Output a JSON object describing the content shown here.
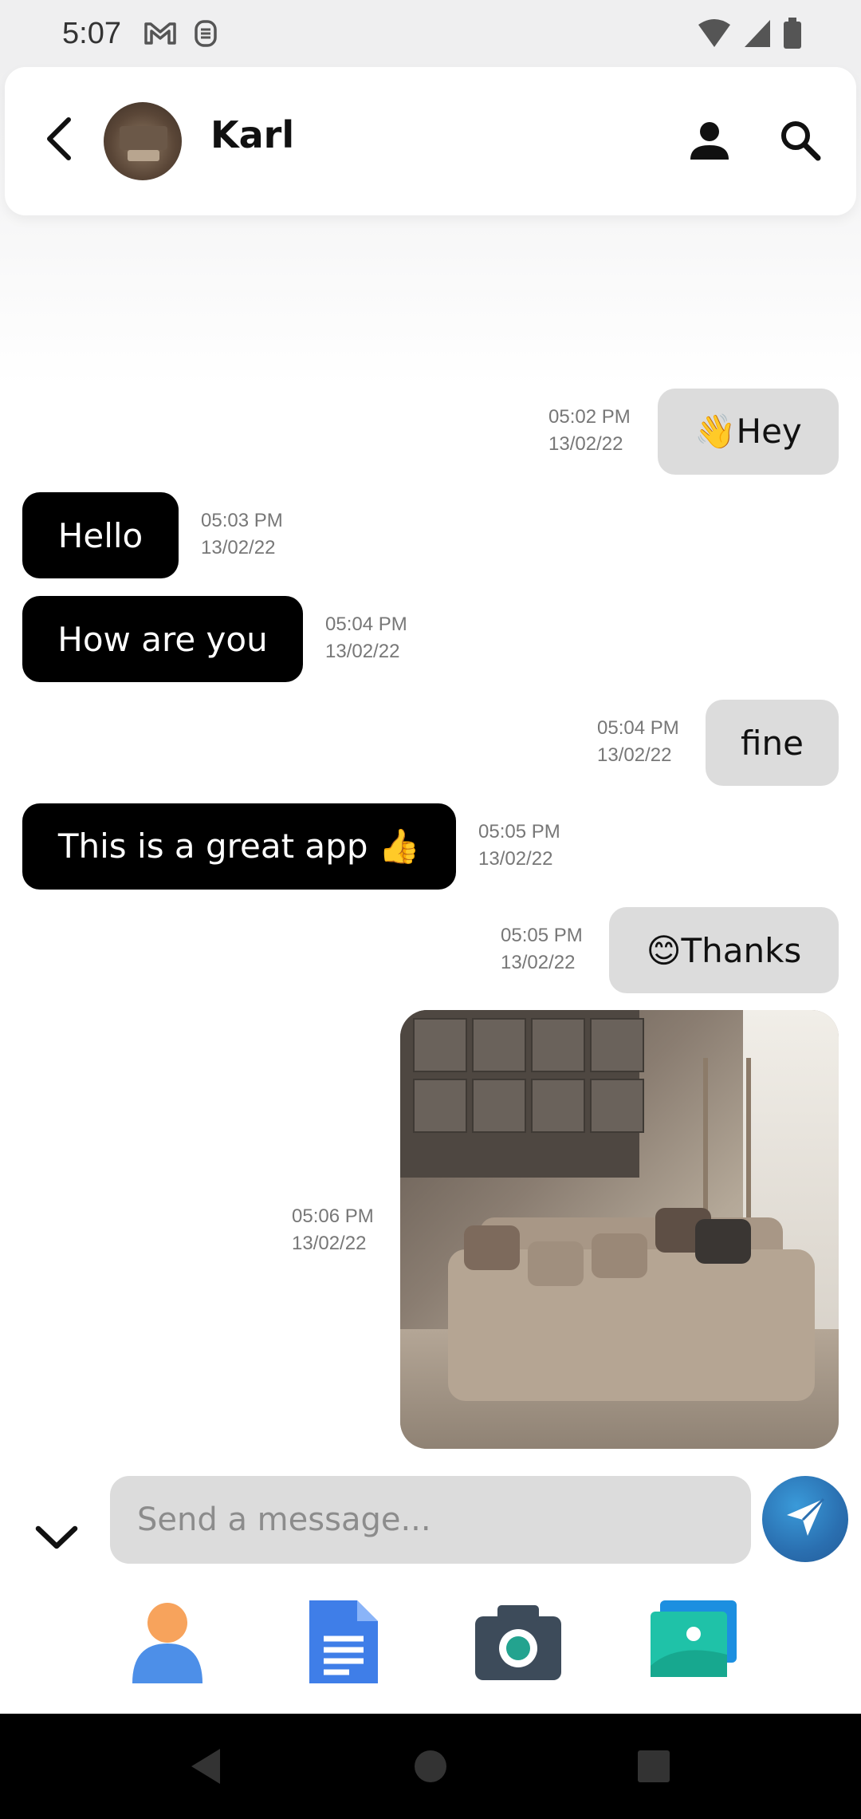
{
  "status_bar": {
    "time": "5:07",
    "icons": [
      "gmail-icon",
      "sim-icon",
      "wifi-icon",
      "signal-icon",
      "battery-icon"
    ]
  },
  "header": {
    "contact_name": "Karl",
    "icons": [
      "back-arrow-icon",
      "profile-icon",
      "search-icon"
    ]
  },
  "messages": [
    {
      "direction": "outgoing",
      "text": "👋Hey",
      "time": "05:02 PM",
      "date": "13/02/22"
    },
    {
      "direction": "incoming",
      "text": "Hello",
      "time": "05:03 PM",
      "date": "13/02/22"
    },
    {
      "direction": "incoming",
      "text": "How are you",
      "time": "05:04 PM",
      "date": "13/02/22"
    },
    {
      "direction": "outgoing",
      "text": "fine",
      "time": "05:04 PM",
      "date": "13/02/22"
    },
    {
      "direction": "incoming",
      "text": "This is a great app 👍",
      "time": "05:05 PM",
      "date": "13/02/22"
    },
    {
      "direction": "outgoing",
      "text": "😊Thanks",
      "time": "05:05 PM",
      "date": "13/02/22"
    },
    {
      "direction": "outgoing",
      "text": "",
      "type": "image",
      "time": "05:06 PM",
      "date": "13/02/22"
    }
  ],
  "composer": {
    "placeholder": "Send a message...",
    "attachments": [
      "contact-attachment-icon",
      "document-attachment-icon",
      "camera-attachment-icon",
      "gallery-attachment-icon"
    ]
  },
  "colors": {
    "incoming_bubble": "#000000",
    "outgoing_bubble": "#dcdcdc",
    "send_button": "#2a6fb0"
  }
}
